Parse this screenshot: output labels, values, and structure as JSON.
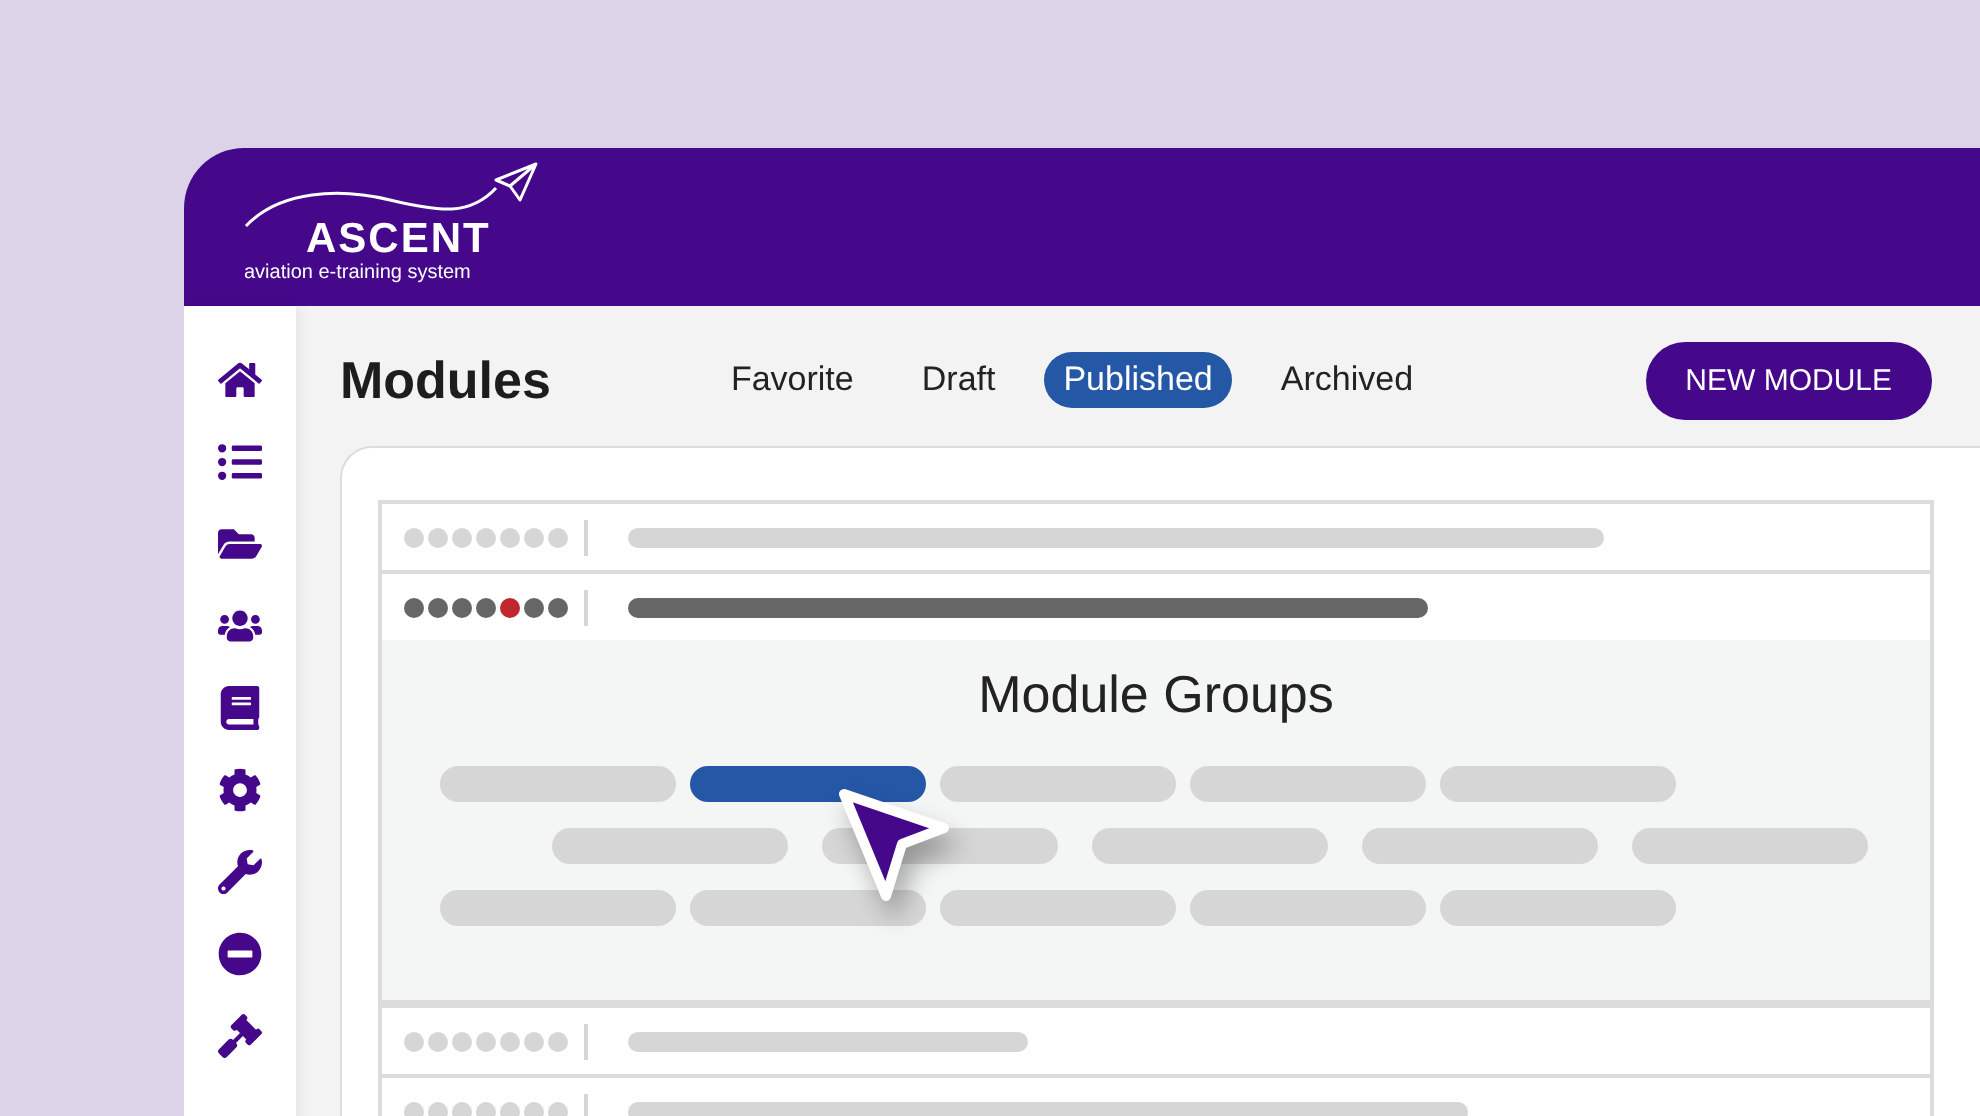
{
  "header": {
    "logo_title": "ASCENT",
    "logo_subtitle": "aviation e-training system"
  },
  "page": {
    "title": "Modules",
    "action": "NEW MODULE",
    "tabs": [
      {
        "label": "Favorite",
        "selected": false
      },
      {
        "label": "Draft",
        "selected": false
      },
      {
        "label": "Published",
        "selected": true
      },
      {
        "label": "Archived",
        "selected": false
      }
    ]
  },
  "rows": [
    {
      "expanded": false,
      "dots": [
        {
          "color": "#d6d6d6"
        },
        {
          "color": "#d6d6d6"
        },
        {
          "color": "#d6d6d6"
        },
        {
          "color": "#d6d6d6"
        },
        {
          "color": "#d6d6d6"
        },
        {
          "color": "#d6d6d6"
        },
        {
          "color": "#d6d6d6"
        }
      ]
    },
    {
      "expanded": true,
      "dots": [
        {
          "color": "#666666"
        },
        {
          "color": "#666666"
        },
        {
          "color": "#666666"
        },
        {
          "color": "#666666"
        },
        {
          "color": "#c0282d"
        },
        {
          "color": "#666666"
        },
        {
          "color": "#666666"
        }
      ]
    },
    {
      "expanded": false,
      "dots": [
        {
          "color": "#d6d6d6"
        },
        {
          "color": "#d6d6d6"
        },
        {
          "color": "#d6d6d6"
        },
        {
          "color": "#d6d6d6"
        },
        {
          "color": "#d6d6d6"
        },
        {
          "color": "#d6d6d6"
        },
        {
          "color": "#d6d6d6"
        }
      ]
    },
    {
      "expanded": false,
      "dots": [
        {
          "color": "#d6d6d6"
        },
        {
          "color": "#d6d6d6"
        },
        {
          "color": "#d6d6d6"
        },
        {
          "color": "#d6d6d6"
        },
        {
          "color": "#d6d6d6"
        },
        {
          "color": "#d6d6d6"
        },
        {
          "color": "#d6d6d6"
        }
      ]
    }
  ],
  "panel": {
    "title": "Module Groups",
    "chip_rows": [
      [
        {
          "selected": false
        },
        {
          "selected": true
        },
        {
          "selected": false
        },
        {
          "selected": false
        },
        {
          "selected": false
        }
      ],
      [
        {
          "selected": false
        },
        {
          "selected": false
        },
        {
          "selected": false
        },
        {
          "selected": false
        },
        {
          "selected": false
        }
      ],
      [
        {
          "selected": false
        },
        {
          "selected": false
        },
        {
          "selected": false
        },
        {
          "selected": false
        },
        {
          "selected": false
        }
      ]
    ]
  }
}
